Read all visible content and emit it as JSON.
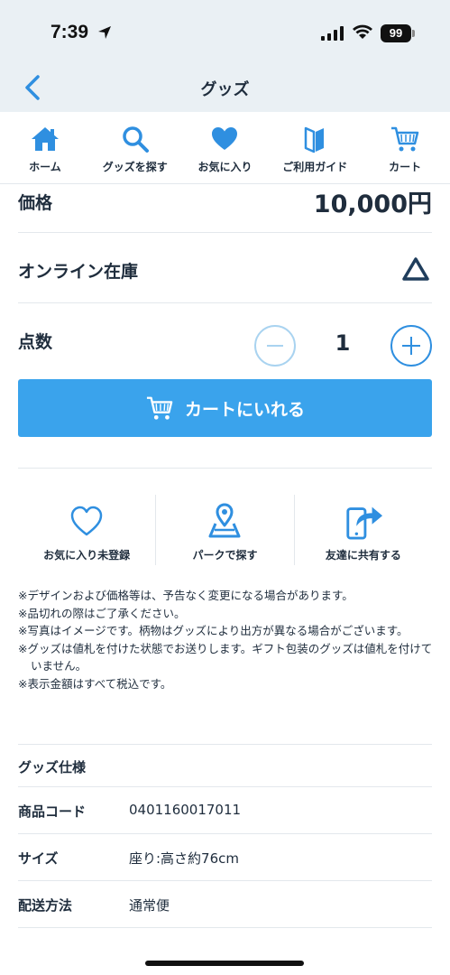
{
  "status_bar": {
    "time": "7:39",
    "battery": "99"
  },
  "header": {
    "title": "グッズ"
  },
  "tabs": [
    {
      "label": "ホーム",
      "icon": "home-icon"
    },
    {
      "label": "グッズを探す",
      "icon": "search-icon"
    },
    {
      "label": "お気に入り",
      "icon": "heart-icon"
    },
    {
      "label": "ご利用ガイド",
      "icon": "guide-icon"
    },
    {
      "label": "カート",
      "icon": "cart-icon"
    }
  ],
  "product": {
    "price_label": "価格",
    "price_value": "10,000円",
    "stock_label": "オンライン在庫",
    "stock_status": "△",
    "quantity_label": "点数",
    "quantity": "1",
    "add_to_cart_label": "カートにいれる"
  },
  "actions": [
    {
      "label": "お気に入り未登録",
      "icon": "heart-outline-icon"
    },
    {
      "label": "パークで探す",
      "icon": "map-pin-icon"
    },
    {
      "label": "友達に共有する",
      "icon": "share-icon"
    }
  ],
  "notes": [
    "※デザインおよび価格等は、予告なく変更になる場合があります。",
    "※品切れの際はご了承ください。",
    "※写真はイメージです。柄物はグッズにより出方が異なる場合がございます。",
    "※グッズは値札を付けた状態でお送りします。ギフト包装のグッズは値札を付けていません。",
    "※表示金額はすべて税込です。"
  ],
  "specs": {
    "title": "グッズ仕様",
    "rows": [
      {
        "key": "商品コード",
        "value": "0401160017011"
      },
      {
        "key": "サイズ",
        "value": "座り:高さ約76cm"
      },
      {
        "key": "配送方法",
        "value": "通常便"
      }
    ]
  },
  "colors": {
    "accent": "#3aa3ec",
    "header_bg": "#eaf0f4",
    "text": "#1f2d3d"
  }
}
